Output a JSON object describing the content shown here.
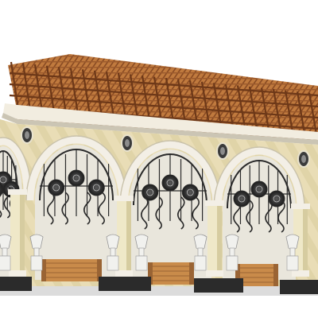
{
  "scene": {
    "name": "arched-pergola-colonnade-render"
  },
  "colors": {
    "background": "#ffffff",
    "pergola_wood": "#b06a34",
    "pergola_dark": "#7a4322",
    "facade": "#e8dcb4",
    "facade_shadow": "#cfc291",
    "arch_trim": "#f3efe6",
    "column": "#efe8c8",
    "column_shadow": "#d6cca0",
    "ironwork": "#2a2a2a",
    "pedestal": "#2b2b2b",
    "bench": "#c98b4a",
    "bench_dark": "#9a6434",
    "urn": "#f1f1ee",
    "floor": "#d8d8d8"
  }
}
